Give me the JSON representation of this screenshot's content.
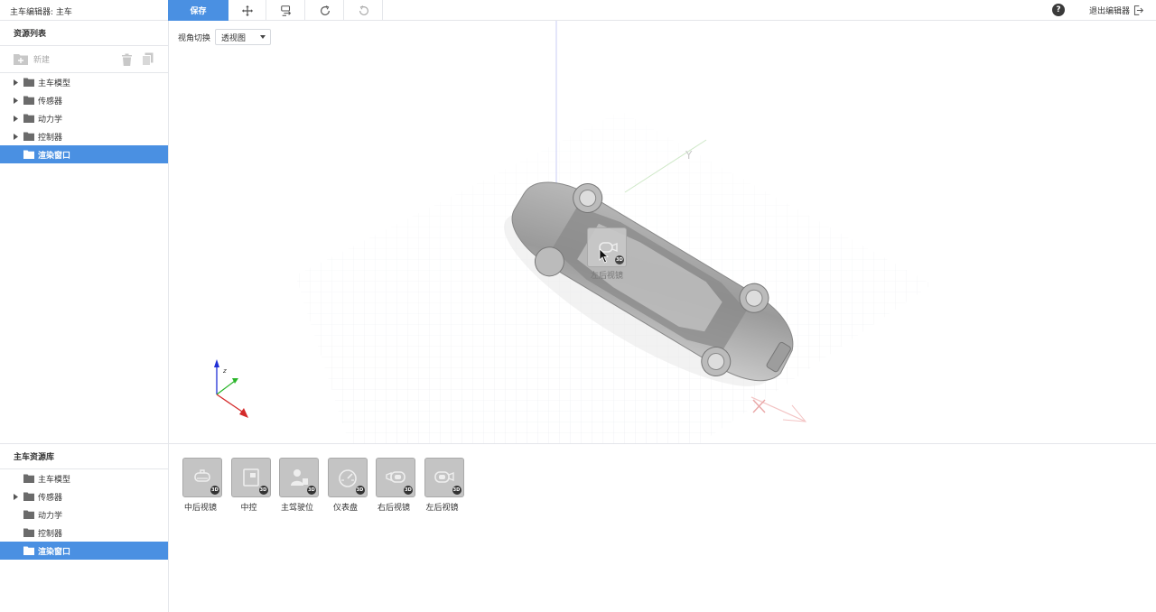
{
  "app": {
    "title": "主车编辑器: 主车"
  },
  "toolbar": {
    "save_label": "保存",
    "tools": [
      "move-icon",
      "transform-icon",
      "redo-icon",
      "undo-icon"
    ],
    "help_label": "?",
    "exit_label": "退出编辑器"
  },
  "resource_panel": {
    "title": "资源列表",
    "new_label": "新建",
    "items": [
      {
        "label": "主车模型",
        "expandable": true,
        "active": false
      },
      {
        "label": "传感器",
        "expandable": true,
        "active": false
      },
      {
        "label": "动力学",
        "expandable": true,
        "active": false
      },
      {
        "label": "控制器",
        "expandable": true,
        "active": false
      },
      {
        "label": "渲染窗口",
        "expandable": false,
        "active": true
      }
    ]
  },
  "viewport": {
    "view_switch_label": "视角切换",
    "view_selected": "透视图",
    "axis_labels": {
      "y": "Y",
      "z": "z"
    },
    "drag_label": "左后视镜"
  },
  "library_panel": {
    "title": "主车资源库",
    "items": [
      {
        "label": "主车模型",
        "expandable": false,
        "active": false
      },
      {
        "label": "传感器",
        "expandable": true,
        "active": false
      },
      {
        "label": "动力学",
        "expandable": false,
        "active": false
      },
      {
        "label": "控制器",
        "expandable": false,
        "active": false
      },
      {
        "label": "渲染窗口",
        "expandable": false,
        "active": true
      }
    ]
  },
  "assets": [
    {
      "label": "中后视镜",
      "icon": "center-mirror-icon",
      "badge": "3D"
    },
    {
      "label": "中控",
      "icon": "center-console-icon",
      "badge": "3D"
    },
    {
      "label": "主驾驶位",
      "icon": "driver-seat-icon",
      "badge": "3D"
    },
    {
      "label": "仪表盘",
      "icon": "dashboard-icon",
      "badge": "3D"
    },
    {
      "label": "右后视镜",
      "icon": "right-mirror-icon",
      "badge": "3D"
    },
    {
      "label": "左后视镜",
      "icon": "left-mirror-icon",
      "badge": "3D"
    }
  ],
  "colors": {
    "accent": "#4a90e2",
    "border": "#e4e6ea"
  }
}
